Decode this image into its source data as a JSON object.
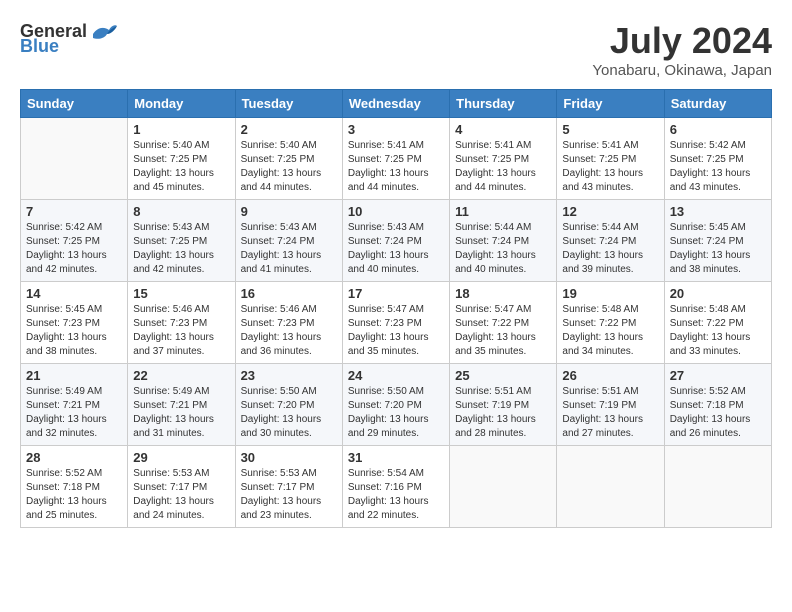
{
  "header": {
    "logo_general": "General",
    "logo_blue": "Blue",
    "title": "July 2024",
    "location": "Yonabaru, Okinawa, Japan"
  },
  "days_of_week": [
    "Sunday",
    "Monday",
    "Tuesday",
    "Wednesday",
    "Thursday",
    "Friday",
    "Saturday"
  ],
  "weeks": [
    [
      {
        "day": "",
        "info": ""
      },
      {
        "day": "1",
        "info": "Sunrise: 5:40 AM\nSunset: 7:25 PM\nDaylight: 13 hours\nand 45 minutes."
      },
      {
        "day": "2",
        "info": "Sunrise: 5:40 AM\nSunset: 7:25 PM\nDaylight: 13 hours\nand 44 minutes."
      },
      {
        "day": "3",
        "info": "Sunrise: 5:41 AM\nSunset: 7:25 PM\nDaylight: 13 hours\nand 44 minutes."
      },
      {
        "day": "4",
        "info": "Sunrise: 5:41 AM\nSunset: 7:25 PM\nDaylight: 13 hours\nand 44 minutes."
      },
      {
        "day": "5",
        "info": "Sunrise: 5:41 AM\nSunset: 7:25 PM\nDaylight: 13 hours\nand 43 minutes."
      },
      {
        "day": "6",
        "info": "Sunrise: 5:42 AM\nSunset: 7:25 PM\nDaylight: 13 hours\nand 43 minutes."
      }
    ],
    [
      {
        "day": "7",
        "info": "Sunrise: 5:42 AM\nSunset: 7:25 PM\nDaylight: 13 hours\nand 42 minutes."
      },
      {
        "day": "8",
        "info": "Sunrise: 5:43 AM\nSunset: 7:25 PM\nDaylight: 13 hours\nand 42 minutes."
      },
      {
        "day": "9",
        "info": "Sunrise: 5:43 AM\nSunset: 7:24 PM\nDaylight: 13 hours\nand 41 minutes."
      },
      {
        "day": "10",
        "info": "Sunrise: 5:43 AM\nSunset: 7:24 PM\nDaylight: 13 hours\nand 40 minutes."
      },
      {
        "day": "11",
        "info": "Sunrise: 5:44 AM\nSunset: 7:24 PM\nDaylight: 13 hours\nand 40 minutes."
      },
      {
        "day": "12",
        "info": "Sunrise: 5:44 AM\nSunset: 7:24 PM\nDaylight: 13 hours\nand 39 minutes."
      },
      {
        "day": "13",
        "info": "Sunrise: 5:45 AM\nSunset: 7:24 PM\nDaylight: 13 hours\nand 38 minutes."
      }
    ],
    [
      {
        "day": "14",
        "info": "Sunrise: 5:45 AM\nSunset: 7:23 PM\nDaylight: 13 hours\nand 38 minutes."
      },
      {
        "day": "15",
        "info": "Sunrise: 5:46 AM\nSunset: 7:23 PM\nDaylight: 13 hours\nand 37 minutes."
      },
      {
        "day": "16",
        "info": "Sunrise: 5:46 AM\nSunset: 7:23 PM\nDaylight: 13 hours\nand 36 minutes."
      },
      {
        "day": "17",
        "info": "Sunrise: 5:47 AM\nSunset: 7:23 PM\nDaylight: 13 hours\nand 35 minutes."
      },
      {
        "day": "18",
        "info": "Sunrise: 5:47 AM\nSunset: 7:22 PM\nDaylight: 13 hours\nand 35 minutes."
      },
      {
        "day": "19",
        "info": "Sunrise: 5:48 AM\nSunset: 7:22 PM\nDaylight: 13 hours\nand 34 minutes."
      },
      {
        "day": "20",
        "info": "Sunrise: 5:48 AM\nSunset: 7:22 PM\nDaylight: 13 hours\nand 33 minutes."
      }
    ],
    [
      {
        "day": "21",
        "info": "Sunrise: 5:49 AM\nSunset: 7:21 PM\nDaylight: 13 hours\nand 32 minutes."
      },
      {
        "day": "22",
        "info": "Sunrise: 5:49 AM\nSunset: 7:21 PM\nDaylight: 13 hours\nand 31 minutes."
      },
      {
        "day": "23",
        "info": "Sunrise: 5:50 AM\nSunset: 7:20 PM\nDaylight: 13 hours\nand 30 minutes."
      },
      {
        "day": "24",
        "info": "Sunrise: 5:50 AM\nSunset: 7:20 PM\nDaylight: 13 hours\nand 29 minutes."
      },
      {
        "day": "25",
        "info": "Sunrise: 5:51 AM\nSunset: 7:19 PM\nDaylight: 13 hours\nand 28 minutes."
      },
      {
        "day": "26",
        "info": "Sunrise: 5:51 AM\nSunset: 7:19 PM\nDaylight: 13 hours\nand 27 minutes."
      },
      {
        "day": "27",
        "info": "Sunrise: 5:52 AM\nSunset: 7:18 PM\nDaylight: 13 hours\nand 26 minutes."
      }
    ],
    [
      {
        "day": "28",
        "info": "Sunrise: 5:52 AM\nSunset: 7:18 PM\nDaylight: 13 hours\nand 25 minutes."
      },
      {
        "day": "29",
        "info": "Sunrise: 5:53 AM\nSunset: 7:17 PM\nDaylight: 13 hours\nand 24 minutes."
      },
      {
        "day": "30",
        "info": "Sunrise: 5:53 AM\nSunset: 7:17 PM\nDaylight: 13 hours\nand 23 minutes."
      },
      {
        "day": "31",
        "info": "Sunrise: 5:54 AM\nSunset: 7:16 PM\nDaylight: 13 hours\nand 22 minutes."
      },
      {
        "day": "",
        "info": ""
      },
      {
        "day": "",
        "info": ""
      },
      {
        "day": "",
        "info": ""
      }
    ]
  ]
}
